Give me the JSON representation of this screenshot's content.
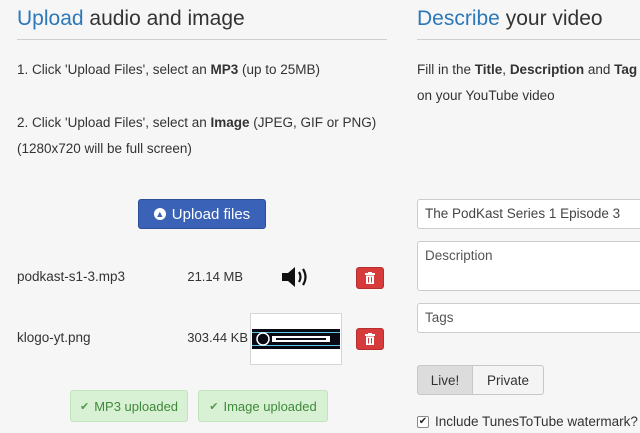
{
  "upload_section": {
    "heading_accent": "Upload",
    "heading_rest": " audio and image",
    "step1_a": "1. Click 'Upload Files', select an ",
    "step1_b": "MP3",
    "step1_c": " (up to 25MB)",
    "step2_a": "2. Click 'Upload Files', select an ",
    "step2_b": "Image",
    "step2_c": " (JPEG, GIF or PNG)",
    "step2_line2": "(1280x720 will be full screen)",
    "upload_button": "Upload files",
    "files": [
      {
        "name": "podkast-s1-3.mp3",
        "size": "21.14 MB",
        "preview": "speaker-icon"
      },
      {
        "name": "klogo-yt.png",
        "size": "303.44 KB",
        "preview": "image-thumbnail"
      }
    ],
    "thumbnail_text": "KOSTERBOROS",
    "badges": {
      "mp3": "MP3 uploaded",
      "image": "Image uploaded"
    }
  },
  "describe_section": {
    "heading_accent": "Describe",
    "heading_rest": " your video",
    "text_a": "Fill in the ",
    "text_b": "Title",
    "text_c": ", ",
    "text_d": "Description",
    "text_e": " and ",
    "text_f": "Tag",
    "text_line2": "on your YouTube video",
    "title_value": "The PodKast Series 1 Episode 3",
    "description_placeholder": "Description",
    "tags_placeholder": "Tags",
    "privacy": {
      "live": "Live!",
      "private": "Private",
      "selected": "Live!"
    },
    "watermark_label": "Include TunesToTube watermark?",
    "watermark_checked": true
  },
  "colors": {
    "accent": "#2c78b9",
    "primary_button": "#3a62b6",
    "danger": "#d63a3a",
    "success_bg": "#d8f0d4",
    "success_text": "#3f8a3a"
  }
}
